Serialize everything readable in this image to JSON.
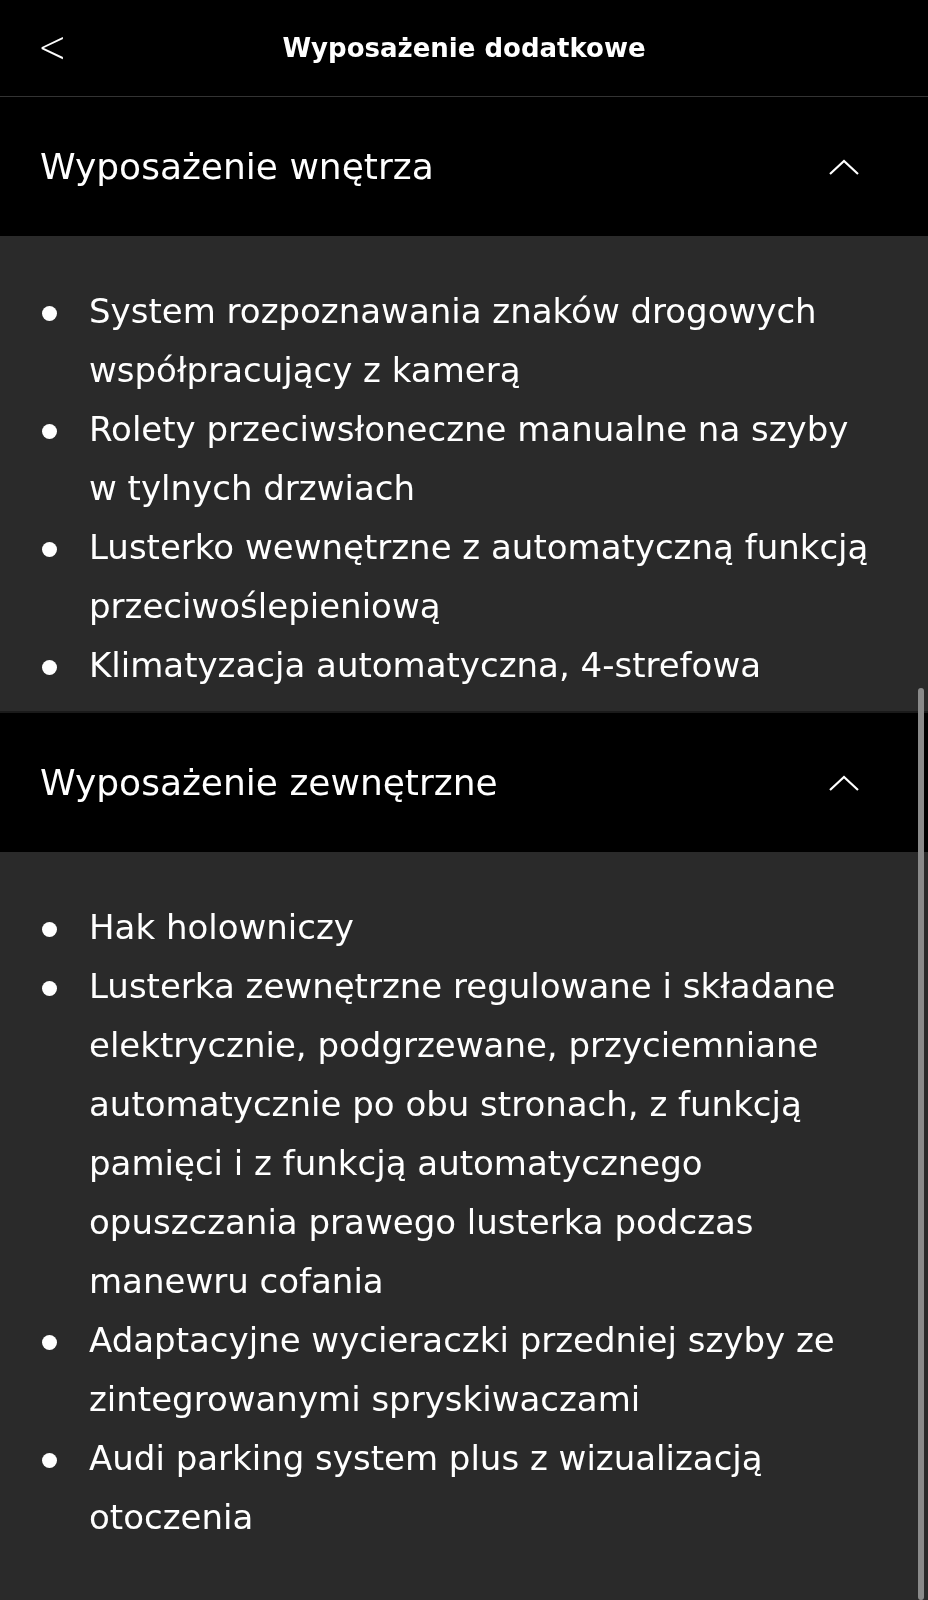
{
  "header": {
    "back": "<",
    "title": "Wyposażenie dodatkowe"
  },
  "sections": [
    {
      "title": "Wyposażenie wnętrza",
      "expanded": true,
      "items": [
        "System rozpoznawania znaków drogowych współpracujący z kamerą",
        "Rolety przeciwsłoneczne manualne na szyby w tylnych drzwiach",
        "Lusterko wewnętrzne z automatyczną funkcją przeciwoślepieniową",
        "Klimatyzacja automatyczna, 4-strefowa"
      ]
    },
    {
      "title": "Wyposażenie zewnętrzne",
      "expanded": true,
      "items": [
        "Hak holowniczy",
        "Lusterka zewnętrzne regulowane i składane elektrycznie, podgrzewane, przyciemniane automatycznie po obu stronach, z funkcją pamięci i z funkcją automatycznego opuszczania prawego lusterka podczas manewru cofania",
        "Adaptacyjne wycieraczki przedniej szyby ze zintegrowanymi spryskiwaczami",
        "Audi parking system plus z wizualizacją otoczenia"
      ]
    }
  ]
}
